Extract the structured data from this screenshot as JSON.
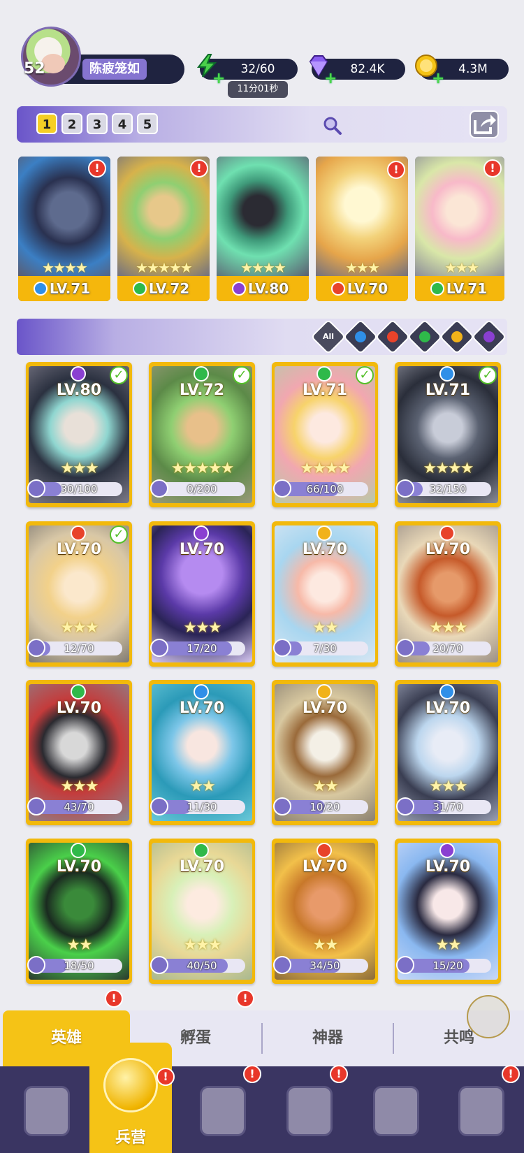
{
  "player": {
    "level": "52",
    "name": "陈疲笼如"
  },
  "resources": {
    "energy": {
      "value": "32/60",
      "timer": "11分01秒"
    },
    "gems": {
      "value": "82.4K"
    },
    "gold": {
      "value": "4.3M"
    }
  },
  "team_tabs": [
    "1",
    "2",
    "3",
    "4",
    "5"
  ],
  "team": [
    {
      "level": "LV.71",
      "stars": "★★★★",
      "element": "water",
      "alert": "!"
    },
    {
      "level": "LV.72",
      "stars": "★★★★★",
      "element": "nature",
      "alert": "!"
    },
    {
      "level": "LV.80",
      "stars": "★★★★",
      "element": "dark",
      "alert": ""
    },
    {
      "level": "LV.70",
      "stars": "★★★",
      "element": "fire",
      "alert": "!"
    },
    {
      "level": "LV.71",
      "stars": "★★★",
      "element": "nature",
      "alert": "!"
    }
  ],
  "filters": {
    "all_label": "All",
    "elements": [
      "water",
      "fire",
      "nature",
      "light",
      "dark"
    ]
  },
  "heroes": [
    {
      "level": "LV.80",
      "element": "dark",
      "checked": true,
      "stars": "★★★",
      "progress": "30/100",
      "fraction": 0.3
    },
    {
      "level": "LV.72",
      "element": "nature",
      "checked": true,
      "stars": "★★★★★",
      "progress": "0/200",
      "fraction": 0.0
    },
    {
      "level": "LV.71",
      "element": "nature",
      "checked": true,
      "stars": "★★★★",
      "progress": "66/100",
      "fraction": 0.66
    },
    {
      "level": "LV.71",
      "element": "water",
      "checked": true,
      "stars": "★★★★",
      "progress": "32/150",
      "fraction": 0.21
    },
    {
      "level": "LV.70",
      "element": "fire",
      "checked": true,
      "stars": "★★★",
      "progress": "12/70",
      "fraction": 0.17
    },
    {
      "level": "LV.70",
      "element": "dark",
      "checked": false,
      "stars": "★★★",
      "progress": "17/20",
      "fraction": 0.85
    },
    {
      "level": "LV.70",
      "element": "light",
      "checked": false,
      "stars": "★★",
      "progress": "7/30",
      "fraction": 0.23
    },
    {
      "level": "LV.70",
      "element": "fire",
      "checked": false,
      "stars": "★★★",
      "progress": "20/70",
      "fraction": 0.29
    },
    {
      "level": "LV.70",
      "element": "nature",
      "checked": false,
      "stars": "★★★",
      "progress": "43/70",
      "fraction": 0.61
    },
    {
      "level": "LV.70",
      "element": "water",
      "checked": false,
      "stars": "★★",
      "progress": "11/30",
      "fraction": 0.37
    },
    {
      "level": "LV.70",
      "element": "light",
      "checked": false,
      "stars": "★★",
      "progress": "10/20",
      "fraction": 0.5
    },
    {
      "level": "LV.70",
      "element": "water",
      "checked": false,
      "stars": "★★★",
      "progress": "31/70",
      "fraction": 0.44
    },
    {
      "level": "LV.70",
      "element": "nature",
      "checked": false,
      "stars": "★★",
      "progress": "18/50",
      "fraction": 0.36
    },
    {
      "level": "LV.70",
      "element": "nature",
      "checked": false,
      "stars": "★★★",
      "progress": "40/50",
      "fraction": 0.8
    },
    {
      "level": "LV.70",
      "element": "fire",
      "checked": false,
      "stars": "★★",
      "progress": "34/50",
      "fraction": 0.68
    },
    {
      "level": "LV.70",
      "element": "dark",
      "checked": false,
      "stars": "★★",
      "progress": "15/20",
      "fraction": 0.75
    }
  ],
  "tabs": [
    {
      "label": "英雄",
      "active": true,
      "alert": "!"
    },
    {
      "label": "孵蛋",
      "active": false,
      "alert": "!"
    },
    {
      "label": "神器",
      "active": false,
      "alert": ""
    },
    {
      "label": "共鸣",
      "active": false,
      "alert": ""
    }
  ],
  "nav": {
    "active_label": "兵营",
    "items": [
      "cards-icon",
      "barracks-icon",
      "map-book-icon",
      "castle-icon",
      "mushroom-house-icon",
      "guild-banner-icon"
    ]
  },
  "colors": {
    "water": "#2f8fe8",
    "fire": "#e8432a",
    "nature": "#2fb94a",
    "light": "#f1b21a",
    "dark": "#8a3fd1",
    "card_gold": "#f2b90c",
    "accent_purple": "#7a68d2"
  }
}
